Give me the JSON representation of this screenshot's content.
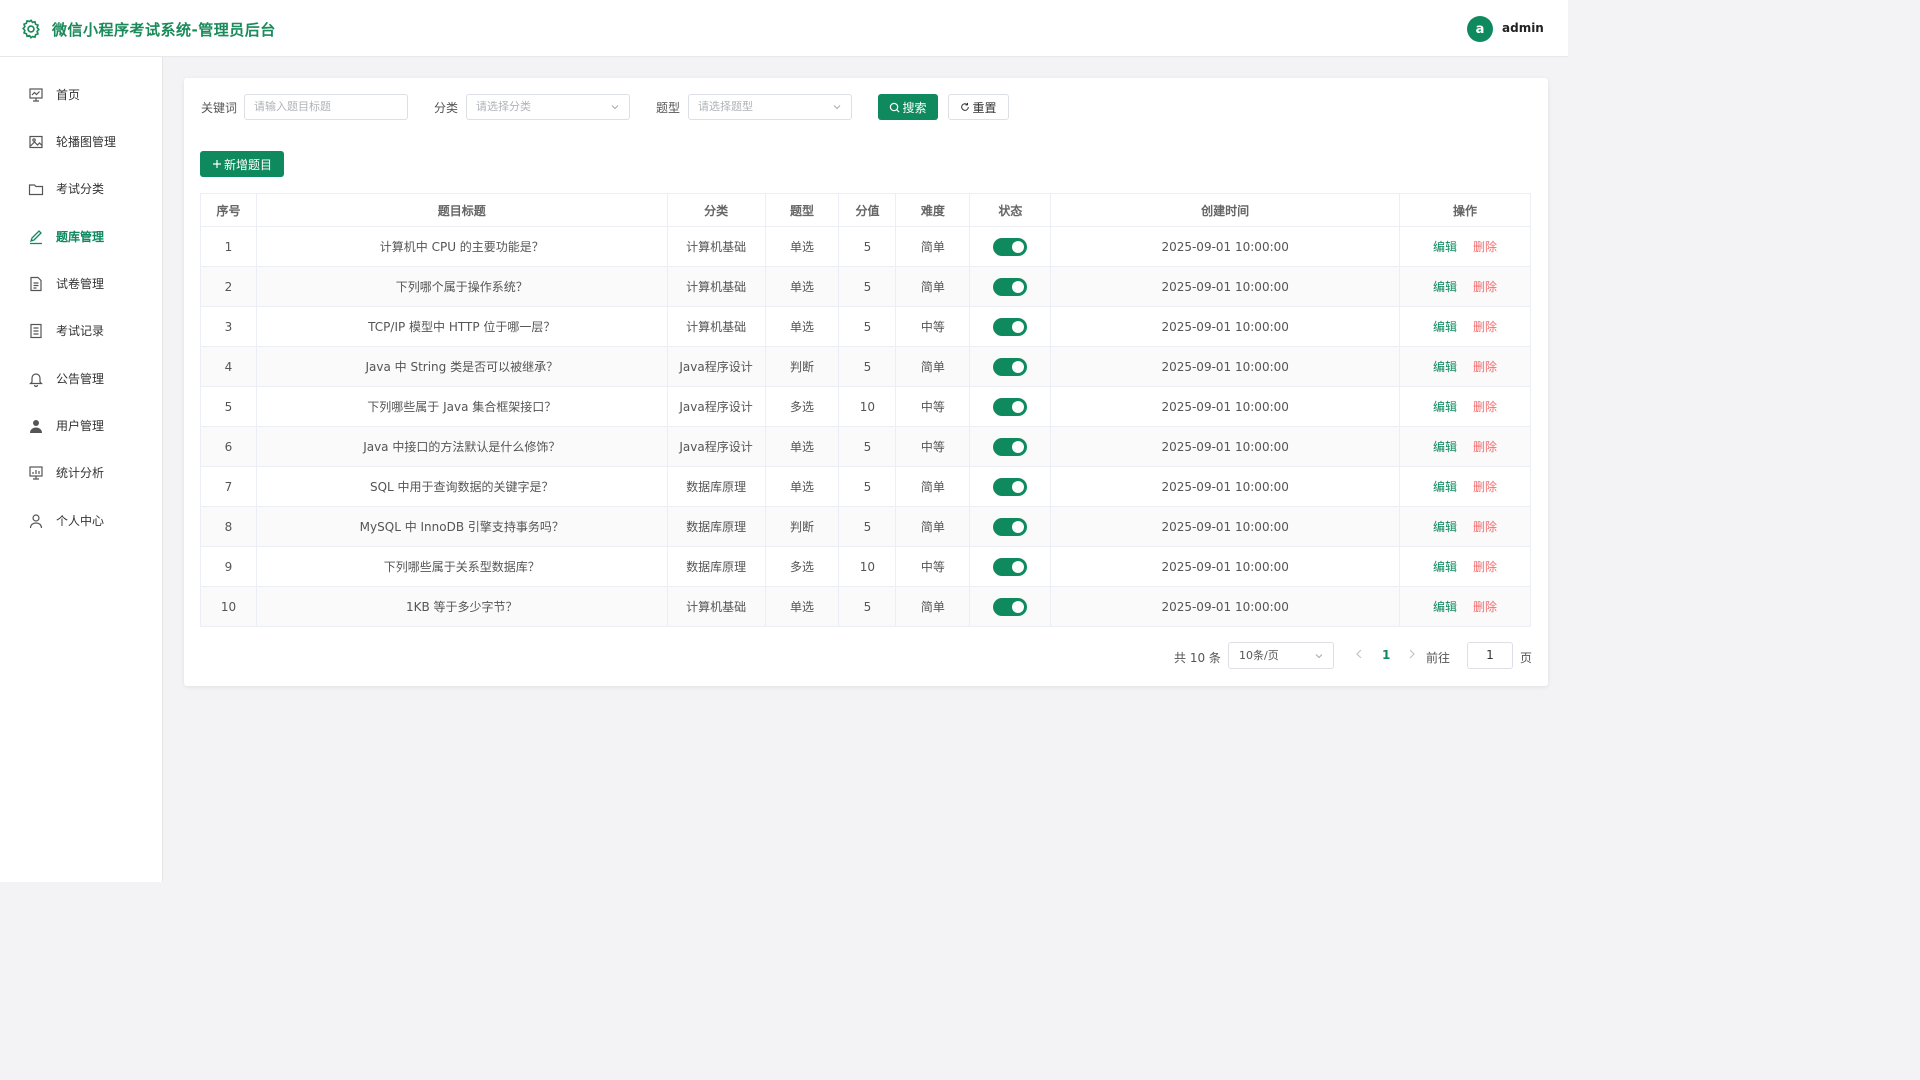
{
  "header": {
    "title": "微信小程序考试系统-管理员后台",
    "avatar_letter": "a",
    "username": "admin"
  },
  "sidebar": {
    "items": [
      {
        "label": "首页",
        "icon": "dashboard-icon"
      },
      {
        "label": "轮播图管理",
        "icon": "image-icon"
      },
      {
        "label": "考试分类",
        "icon": "folder-icon"
      },
      {
        "label": "题库管理",
        "icon": "edit-icon",
        "active": true
      },
      {
        "label": "试卷管理",
        "icon": "document-icon"
      },
      {
        "label": "考试记录",
        "icon": "list-doc-icon"
      },
      {
        "label": "公告管理",
        "icon": "bell-icon"
      },
      {
        "label": "用户管理",
        "icon": "user-filled-icon"
      },
      {
        "label": "统计分析",
        "icon": "chart-icon"
      },
      {
        "label": "个人中心",
        "icon": "user-icon"
      }
    ]
  },
  "filters": {
    "keyword_label": "关键词",
    "keyword_placeholder": "请输入题目标题",
    "category_label": "分类",
    "category_placeholder": "请选择分类",
    "type_label": "题型",
    "type_placeholder": "请选择题型",
    "search_label": "搜索",
    "reset_label": "重置"
  },
  "add_button_label": "新增题目",
  "table": {
    "headers": [
      "序号",
      "题目标题",
      "分类",
      "题型",
      "分值",
      "难度",
      "状态",
      "创建时间",
      "操作"
    ],
    "edit_label": "编辑",
    "delete_label": "删除",
    "rows": [
      {
        "no": "1",
        "title": "计算机中 CPU 的主要功能是？",
        "category": "计算机基础",
        "type": "单选",
        "score": "5",
        "difficulty": "简单",
        "enabled": true,
        "created": "2025-09-01 10:00:00"
      },
      {
        "no": "2",
        "title": "下列哪个属于操作系统？",
        "category": "计算机基础",
        "type": "单选",
        "score": "5",
        "difficulty": "简单",
        "enabled": true,
        "created": "2025-09-01 10:00:00"
      },
      {
        "no": "3",
        "title": "TCP/IP 模型中 HTTP 位于哪一层？",
        "category": "计算机基础",
        "type": "单选",
        "score": "5",
        "difficulty": "中等",
        "enabled": true,
        "created": "2025-09-01 10:00:00"
      },
      {
        "no": "4",
        "title": "Java 中 String 类是否可以被继承？",
        "category": "Java程序设计",
        "type": "判断",
        "score": "5",
        "difficulty": "简单",
        "enabled": true,
        "created": "2025-09-01 10:00:00"
      },
      {
        "no": "5",
        "title": "下列哪些属于 Java 集合框架接口？",
        "category": "Java程序设计",
        "type": "多选",
        "score": "10",
        "difficulty": "中等",
        "enabled": true,
        "created": "2025-09-01 10:00:00"
      },
      {
        "no": "6",
        "title": "Java 中接口的方法默认是什么修饰？",
        "category": "Java程序设计",
        "type": "单选",
        "score": "5",
        "difficulty": "中等",
        "enabled": true,
        "created": "2025-09-01 10:00:00"
      },
      {
        "no": "7",
        "title": "SQL 中用于查询数据的关键字是？",
        "category": "数据库原理",
        "type": "单选",
        "score": "5",
        "difficulty": "简单",
        "enabled": true,
        "created": "2025-09-01 10:00:00"
      },
      {
        "no": "8",
        "title": "MySQL 中 InnoDB 引擎支持事务吗？",
        "category": "数据库原理",
        "type": "判断",
        "score": "5",
        "difficulty": "简单",
        "enabled": true,
        "created": "2025-09-01 10:00:00"
      },
      {
        "no": "9",
        "title": "下列哪些属于关系型数据库？",
        "category": "数据库原理",
        "type": "多选",
        "score": "10",
        "difficulty": "中等",
        "enabled": true,
        "created": "2025-09-01 10:00:00"
      },
      {
        "no": "10",
        "title": "1KB 等于多少字节？",
        "category": "计算机基础",
        "type": "单选",
        "score": "5",
        "difficulty": "简单",
        "enabled": true,
        "created": "2025-09-01 10:00:00"
      }
    ]
  },
  "pagination": {
    "total_text": "共 10 条",
    "page_size": "10条/页",
    "current_page": "1",
    "goto_label": "前往",
    "goto_value": "1",
    "page_suffix": "页"
  },
  "colors": {
    "accent": "#0f8a5f",
    "danger": "#f56c6c"
  }
}
